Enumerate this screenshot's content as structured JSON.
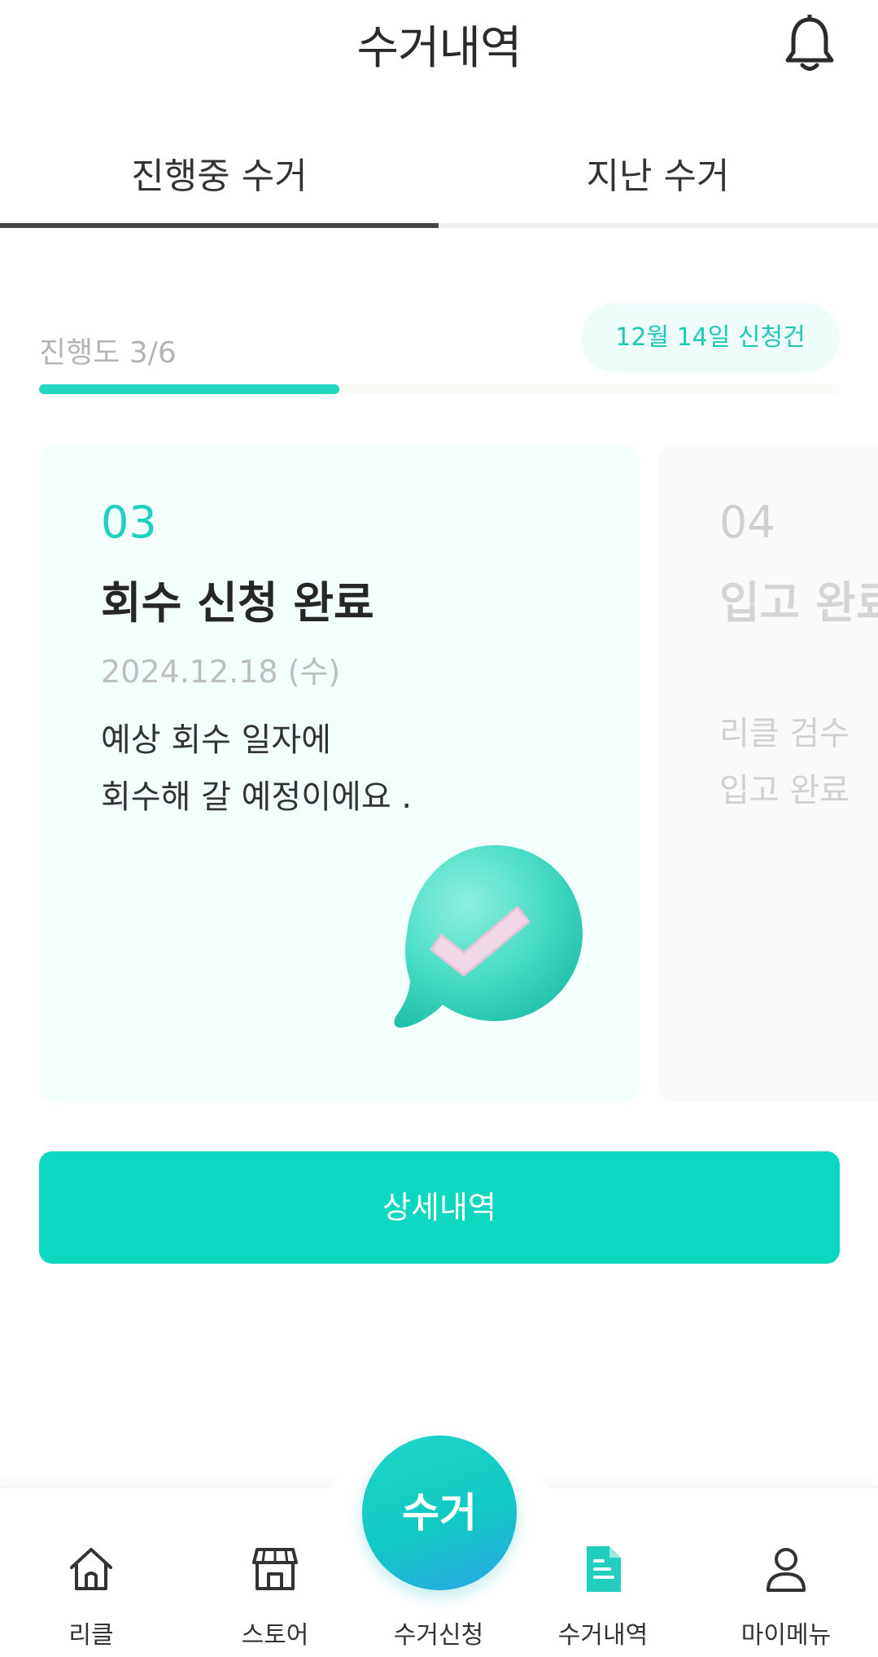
{
  "header": {
    "title": "수거내역",
    "icon": "bell-icon"
  },
  "tabs": [
    {
      "label": "진행중 수거",
      "active": true
    },
    {
      "label": "지난 수거",
      "active": false
    }
  ],
  "progress": {
    "label": "진행도 3/6",
    "fraction": 0.375,
    "request_badge": "12월 14일 신청건"
  },
  "steps": [
    {
      "number": "03",
      "title": "회수 신청 완료",
      "date": "2024.12.18 (수)",
      "desc_line1": "예상 회수 일자에",
      "desc_line2": "회수해 갈 예정이에요 ."
    },
    {
      "number": "04",
      "title": "입고 완료",
      "desc_line1": "리클 검수",
      "desc_line2": "입고 완료"
    }
  ],
  "detail_button": "상세내역",
  "fab_label": "수거",
  "bottom_nav": [
    {
      "label": "리클",
      "icon": "home-icon"
    },
    {
      "label": "스토어",
      "icon": "store-icon"
    },
    {
      "label": "수거신청",
      "icon": ""
    },
    {
      "label": "수거내역",
      "icon": "document-icon",
      "active": true
    },
    {
      "label": "마이메뉴",
      "icon": "user-icon"
    }
  ],
  "colors": {
    "accent": "#0ed7c1",
    "active_tab": "#444444"
  }
}
